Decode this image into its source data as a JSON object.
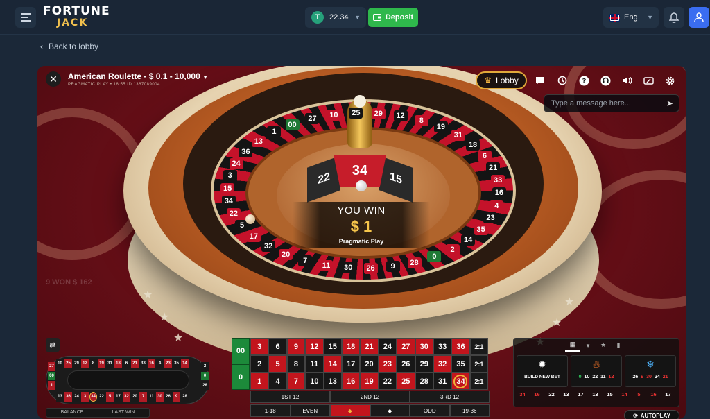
{
  "header": {
    "brand_top": "FORTUNE",
    "brand_bottom": "JACK",
    "balance": "22.34",
    "deposit_label": "Deposit",
    "language": "Eng"
  },
  "nav": {
    "back_label": "Back to lobby"
  },
  "game": {
    "title": "American Roulette - $ 0.1 - 10,000",
    "subtitle": "PRAGMATIC PLAY • 18:55 ID 1367089004",
    "lobby_label": "Lobby",
    "chat_placeholder": "Type a message here...",
    "wheel_numbers": [
      "00",
      "27",
      "10",
      "25",
      "29",
      "12",
      "8",
      "19",
      "31",
      "18",
      "6",
      "21",
      "33",
      "16",
      "4",
      "23",
      "35",
      "14",
      "2",
      "0",
      "28",
      "9",
      "26",
      "30",
      "11",
      "7",
      "20",
      "32",
      "17",
      "5",
      "22",
      "34",
      "15",
      "3",
      "24",
      "36",
      "13",
      "1"
    ],
    "win": {
      "number": "34",
      "left_number": "22",
      "right_number": "15",
      "title": "YOU WIN",
      "amount": "$ 1",
      "provider": "Pragmatic Play"
    },
    "ghost_text": "9 WON $ 162",
    "racetrack": {
      "top": [
        {
          "n": "10",
          "c": "b"
        },
        {
          "n": "25",
          "c": "r"
        },
        {
          "n": "29",
          "c": "b"
        },
        {
          "n": "12",
          "c": "r"
        },
        {
          "n": "8",
          "c": "b"
        },
        {
          "n": "19",
          "c": "r"
        },
        {
          "n": "31",
          "c": "b"
        },
        {
          "n": "18",
          "c": "r"
        },
        {
          "n": "6",
          "c": "b"
        },
        {
          "n": "21",
          "c": "r"
        },
        {
          "n": "33",
          "c": "b"
        },
        {
          "n": "16",
          "c": "r"
        },
        {
          "n": "4",
          "c": "b"
        },
        {
          "n": "23",
          "c": "r"
        },
        {
          "n": "35",
          "c": "b"
        },
        {
          "n": "14",
          "c": "r"
        }
      ],
      "bottom": [
        {
          "n": "13",
          "c": "b"
        },
        {
          "n": "36",
          "c": "r"
        },
        {
          "n": "24",
          "c": "b"
        },
        {
          "n": "3",
          "c": "r"
        },
        {
          "n": "34",
          "c": "r",
          "hl": true
        },
        {
          "n": "22",
          "c": "b"
        },
        {
          "n": "5",
          "c": "r"
        },
        {
          "n": "17",
          "c": "b"
        },
        {
          "n": "32",
          "c": "r"
        },
        {
          "n": "20",
          "c": "b"
        },
        {
          "n": "7",
          "c": "r"
        },
        {
          "n": "11",
          "c": "b"
        },
        {
          "n": "30",
          "c": "r"
        },
        {
          "n": "26",
          "c": "b"
        },
        {
          "n": "9",
          "c": "r"
        },
        {
          "n": "28",
          "c": "b"
        }
      ],
      "left": [
        "27",
        "00",
        "1"
      ],
      "right": [
        "2",
        "0",
        "28"
      ],
      "tab_balance": "BALANCE",
      "tab_last_win": "LAST WIN"
    },
    "table": {
      "zero_top": "00",
      "zero_bottom": "0",
      "rows": [
        [
          {
            "n": "3",
            "c": "r"
          },
          {
            "n": "6",
            "c": "b"
          },
          {
            "n": "9",
            "c": "r"
          },
          {
            "n": "12",
            "c": "r"
          },
          {
            "n": "15",
            "c": "b"
          },
          {
            "n": "18",
            "c": "r"
          },
          {
            "n": "21",
            "c": "r"
          },
          {
            "n": "24",
            "c": "b"
          },
          {
            "n": "27",
            "c": "r"
          },
          {
            "n": "30",
            "c": "r"
          },
          {
            "n": "33",
            "c": "b"
          },
          {
            "n": "36",
            "c": "r"
          },
          {
            "n": "2:1",
            "c": "col"
          }
        ],
        [
          {
            "n": "2",
            "c": "b"
          },
          {
            "n": "5",
            "c": "r"
          },
          {
            "n": "8",
            "c": "b"
          },
          {
            "n": "11",
            "c": "b"
          },
          {
            "n": "14",
            "c": "r"
          },
          {
            "n": "17",
            "c": "b"
          },
          {
            "n": "20",
            "c": "b"
          },
          {
            "n": "23",
            "c": "r"
          },
          {
            "n": "26",
            "c": "b"
          },
          {
            "n": "29",
            "c": "b"
          },
          {
            "n": "32",
            "c": "r"
          },
          {
            "n": "35",
            "c": "b"
          },
          {
            "n": "2:1",
            "c": "col"
          }
        ],
        [
          {
            "n": "1",
            "c": "r"
          },
          {
            "n": "4",
            "c": "b"
          },
          {
            "n": "7",
            "c": "r"
          },
          {
            "n": "10",
            "c": "b"
          },
          {
            "n": "16",
            "c": "r"
          },
          {
            "n": "19",
            "c": "r"
          },
          {
            "n": "22",
            "c": "b"
          },
          {
            "n": "25",
            "c": "r"
          },
          {
            "n": "28",
            "c": "b"
          },
          {
            "n": "31",
            "c": "b"
          },
          {
            "n": "34",
            "c": "r",
            "hl": true
          },
          {
            "n": "2:1",
            "c": "col"
          }
        ]
      ],
      "dozens": [
        "1ST 12",
        "2ND 12",
        "3RD 12"
      ],
      "outside": [
        "1-18",
        "EVEN",
        "",
        "",
        "ODD",
        "19-36"
      ]
    },
    "stats": {
      "build_new_bet": "BUILD NEW BET",
      "hot": [
        {
          "n": "0",
          "c": "#2fc45a"
        },
        {
          "n": "10",
          "c": "#fff"
        },
        {
          "n": "22",
          "c": "#fff"
        },
        {
          "n": "11",
          "c": "#fff"
        },
        {
          "n": "12",
          "c": "#e33"
        }
      ],
      "cold": [
        {
          "n": "26",
          "c": "#fff"
        },
        {
          "n": "9",
          "c": "#e33"
        },
        {
          "n": "30",
          "c": "#e33"
        },
        {
          "n": "24",
          "c": "#fff"
        },
        {
          "n": "21",
          "c": "#e33"
        }
      ],
      "history": [
        {
          "n": "34",
          "c": "#e33"
        },
        {
          "n": "16",
          "c": "#e33"
        },
        {
          "n": "22",
          "c": "#fff"
        },
        {
          "n": "13",
          "c": "#fff"
        },
        {
          "n": "17",
          "c": "#fff"
        },
        {
          "n": "13",
          "c": "#fff"
        },
        {
          "n": "15",
          "c": "#fff"
        },
        {
          "n": "14",
          "c": "#e33"
        },
        {
          "n": "5",
          "c": "#e33"
        },
        {
          "n": "16",
          "c": "#e33"
        },
        {
          "n": "17",
          "c": "#fff"
        }
      ],
      "autoplay_label": "AUTOPLAY"
    }
  }
}
